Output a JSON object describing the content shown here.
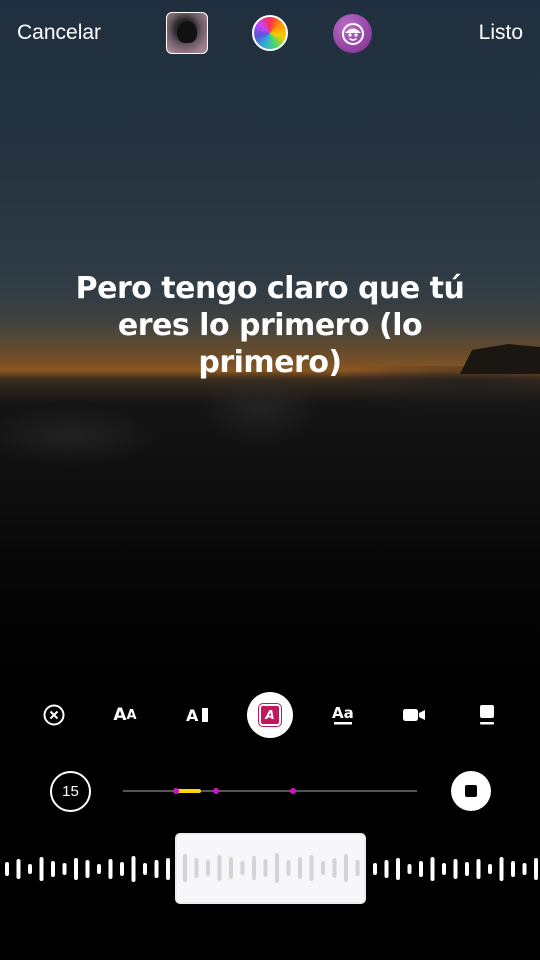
{
  "topbar": {
    "cancel_label": "Cancelar",
    "done_label": "Listo",
    "album_icon": "album-cover-icon",
    "color_icon": "color-wheel-icon",
    "effect_icon": "face-effect-icon"
  },
  "lyrics": {
    "text": "Pero tengo claro que tú eres lo primero (lo primero)"
  },
  "toolbar": {
    "tools": [
      "remove-lyrics-icon",
      "text-size-icon",
      "text-style-icon",
      "highlight-style-icon",
      "font-icon",
      "video-icon",
      "background-icon"
    ],
    "active_tool": "highlight-style-icon",
    "highlight_color": "#c2185b"
  },
  "timeline": {
    "duration": "15",
    "segment_color": "#ffd60a",
    "marker_color": "#d011c8"
  },
  "waveform": {
    "selection_color": "#f7f7f9"
  }
}
